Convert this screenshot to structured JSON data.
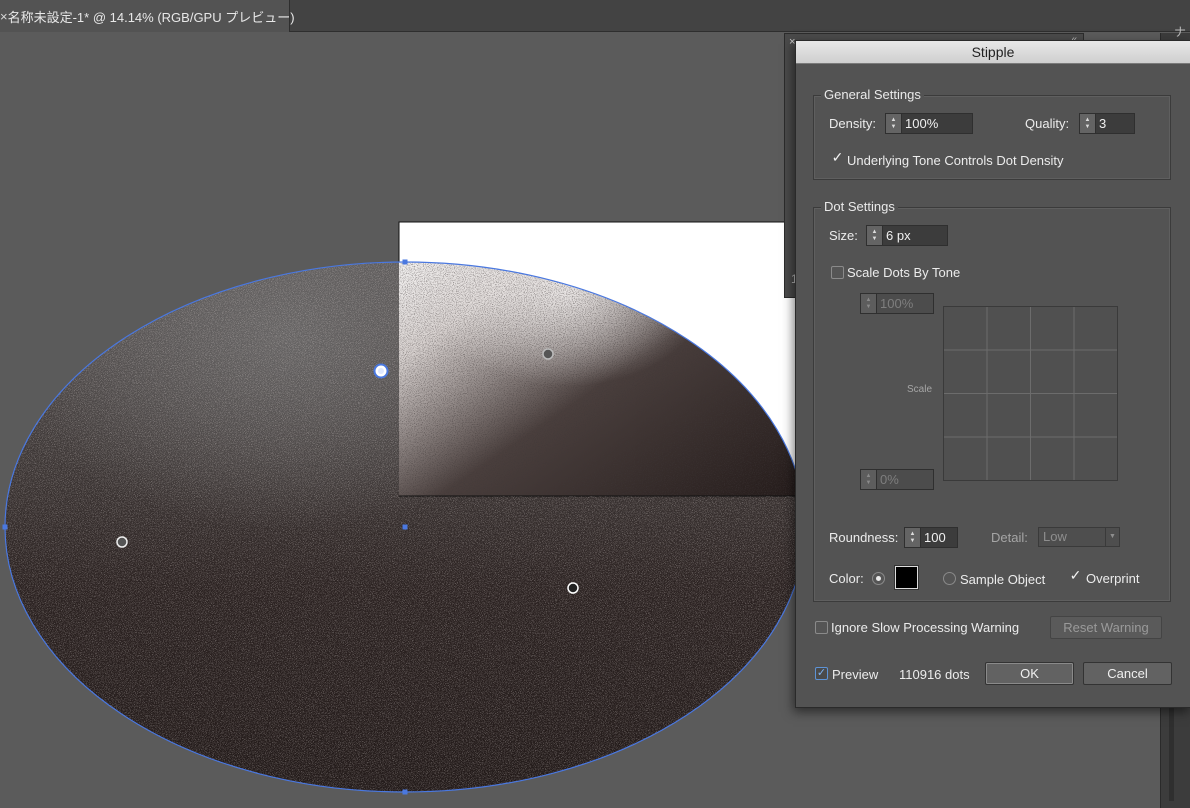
{
  "document": {
    "close_glyph": "×",
    "tab_title": "名称未設定-1* @ 14.14% (RGB/GPU プレビュー)"
  },
  "right_strip": {
    "glyph": "ナ"
  },
  "back_panel": {
    "close_glyph": "×",
    "expand_glyph": "«",
    "label": "1"
  },
  "dialog": {
    "title": "Stipple",
    "general": {
      "title": "General Settings",
      "density_label": "Density:",
      "density_value": "100%",
      "quality_label": "Quality:",
      "quality_value": "3",
      "underlying_tone_label": "Underlying Tone Controls Dot Density",
      "underlying_tone_checked": true
    },
    "dots": {
      "title": "Dot Settings",
      "size_label": "Size:",
      "size_value": "6 px",
      "scale_by_tone_label": "Scale Dots By Tone",
      "scale_by_tone_checked": false,
      "scale_max": "100%",
      "scale_min": "0%",
      "scale_axis_label": "Scale",
      "roundness_label": "Roundness:",
      "roundness_value": "100",
      "detail_label": "Detail:",
      "detail_value": "Low",
      "color_label": "Color:",
      "color_value": "#000000",
      "sample_object_label": "Sample Object",
      "overprint_label": "Overprint",
      "overprint_checked": true
    },
    "ignore_warning_label": "Ignore Slow Processing Warning",
    "ignore_warning_checked": false,
    "reset_warning_label": "Reset Warning",
    "preview_label": "Preview",
    "preview_checked": true,
    "dots_count": "110916 dots",
    "ok_label": "OK",
    "cancel_label": "Cancel"
  },
  "icons": {
    "check": "✓",
    "arrow_up": "▲",
    "arrow_down": "▼",
    "caret_down": "▼"
  },
  "colors": {
    "selection": "#4a78e0",
    "stipple_dark": "#221a19",
    "canvas_bg": "#5b5b5b",
    "dialog_bg": "#535353"
  }
}
